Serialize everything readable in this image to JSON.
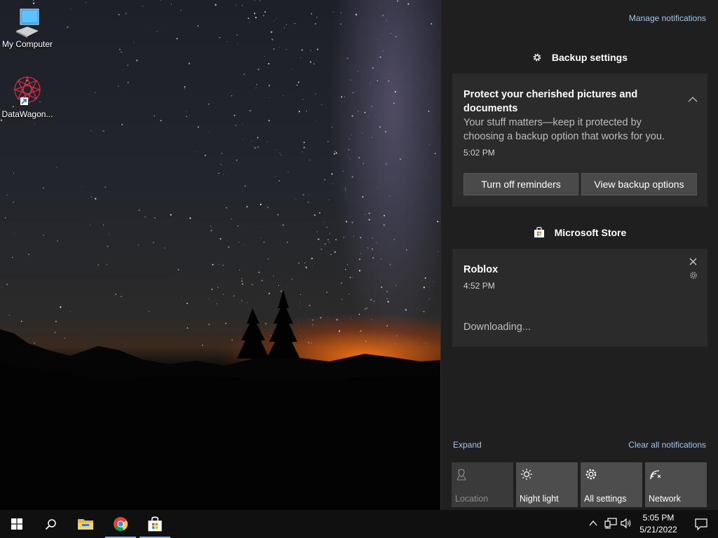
{
  "desktop": {
    "icons": [
      {
        "label": "My Computer"
      },
      {
        "label": "DataWagon..."
      }
    ]
  },
  "action_center": {
    "manage_link": "Manage notifications",
    "groups": [
      {
        "header": "Backup settings",
        "icon": "gear-icon",
        "notification": {
          "title_line1": "Protect your cherished pictures and",
          "title_line2": "documents",
          "body_line1": "Your stuff matters—keep it protected by",
          "body_line2": "choosing a backup option that works for you.",
          "time": "5:02 PM",
          "buttons": [
            "Turn off reminders",
            "View backup options"
          ]
        }
      },
      {
        "header": "Microsoft Store",
        "icon": "store-icon",
        "notification": {
          "title": "Roblox",
          "time": "4:52 PM",
          "status": "Downloading..."
        }
      }
    ],
    "expand_link": "Expand",
    "clear_link": "Clear all notifications",
    "quick_actions": [
      {
        "label": "Location",
        "icon": "location-icon",
        "enabled": false
      },
      {
        "label": "Night light",
        "icon": "night-light-icon",
        "enabled": true
      },
      {
        "label": "All settings",
        "icon": "settings-icon",
        "enabled": true
      },
      {
        "label": "Network",
        "icon": "network-icon",
        "enabled": true
      }
    ]
  },
  "taskbar": {
    "apps": [
      "start-icon",
      "search-icon",
      "file-explorer-icon",
      "chrome-icon",
      "store-icon"
    ],
    "clock": {
      "time": "5:05 PM",
      "date": "5/21/2022"
    }
  },
  "colors": {
    "panel_bg": "#1f1f1f",
    "card_bg": "#2b2b2b",
    "link": "#9cc7ec",
    "tile_bg": "#4d4d4d",
    "taskbar_bg": "#101010"
  }
}
